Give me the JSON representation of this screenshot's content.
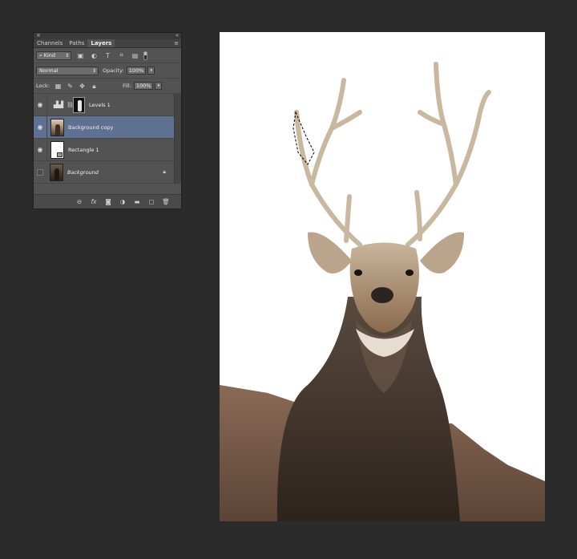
{
  "panel": {
    "close_glyph": "×",
    "collapse_glyph": "«",
    "tabs": [
      {
        "label": "Channels",
        "active": false
      },
      {
        "label": "Paths",
        "active": false
      },
      {
        "label": "Layers",
        "active": true
      }
    ],
    "menu_glyph": "≡",
    "filter": {
      "label": "Kind",
      "icons": [
        "pixel-filter-icon",
        "adjustment-filter-icon",
        "type-filter-icon",
        "shape-filter-icon",
        "smart-object-filter-icon"
      ]
    },
    "blend_mode": "Normal",
    "opacity_label": "Opacity:",
    "opacity_value": "100%",
    "lock_label": "Lock:",
    "fill_label": "Fill:",
    "fill_value": "100%",
    "layers": [
      {
        "name": "Levels 1",
        "visible": true,
        "type": "adjustment"
      },
      {
        "name": "Background copy",
        "visible": true,
        "type": "pixel",
        "selected": true
      },
      {
        "name": "Rectangle 1",
        "visible": true,
        "type": "shape"
      },
      {
        "name": "Background",
        "visible": false,
        "type": "background",
        "locked": true
      }
    ],
    "bottom_icons": [
      "link-layers-icon",
      "fx-icon",
      "add-mask-icon",
      "new-adjustment-icon",
      "new-group-icon",
      "new-layer-icon",
      "delete-layer-icon"
    ],
    "fx_label": "fx"
  },
  "colors": {
    "background": "#2b2b2b",
    "panel": "#535353",
    "selected_layer": "#5f7190"
  }
}
